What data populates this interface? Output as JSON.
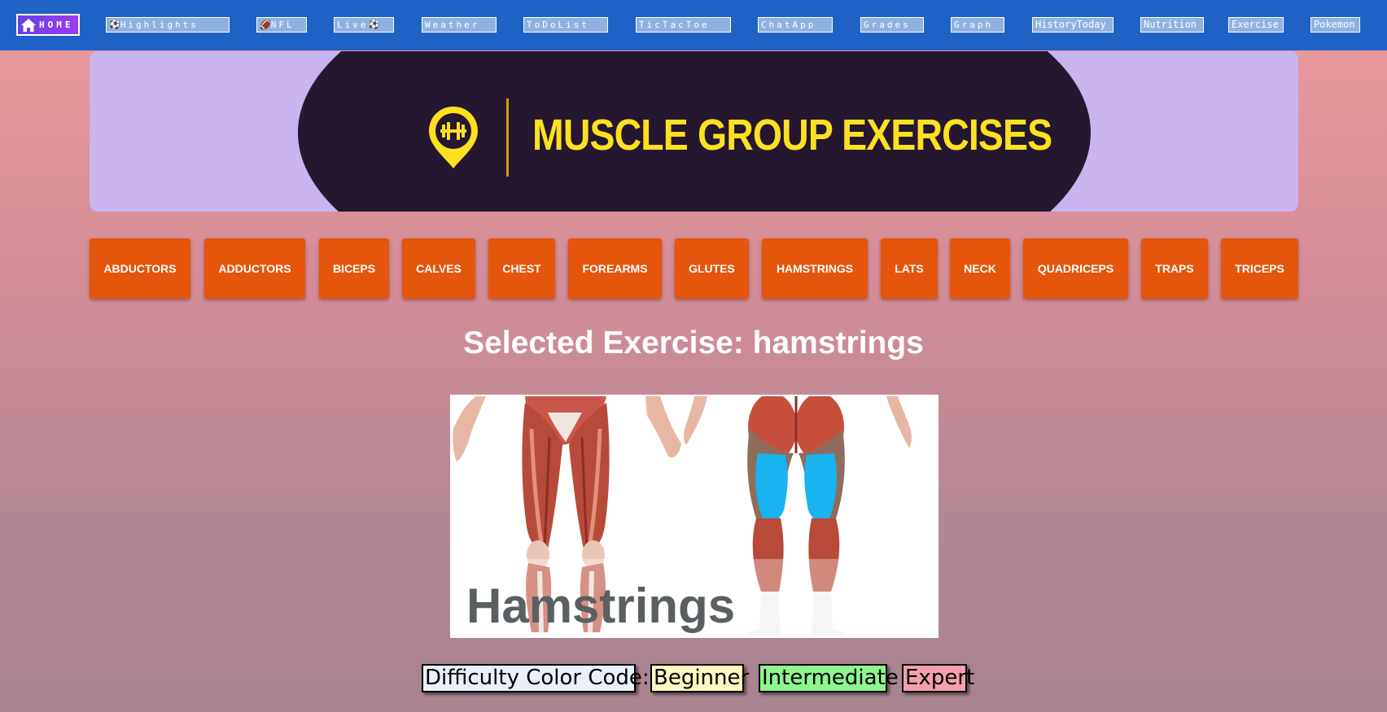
{
  "navbar": {
    "home_label": "HOME",
    "links": [
      {
        "label": "Highlights",
        "icon": "soccer-ball-icon"
      },
      {
        "label": "NFL",
        "icon": "football-icon"
      },
      {
        "label": "Live",
        "icon": "soccer-ball-icon"
      },
      {
        "label": "Weather"
      },
      {
        "label": "ToDoList"
      },
      {
        "label": "TicTacToe"
      },
      {
        "label": "ChatApp"
      },
      {
        "label": "Grades"
      },
      {
        "label": "Graph"
      },
      {
        "label": "HistoryToday"
      },
      {
        "label": "Nutrition"
      },
      {
        "label": "Exercise"
      },
      {
        "label": "Pokemon"
      }
    ]
  },
  "banner": {
    "title": "MUSCLE GROUP EXERCISES",
    "logo_icon": "dumbbell-pin-icon"
  },
  "muscle_groups": [
    "ABDUCTORS",
    "ADDUCTORS",
    "BICEPS",
    "CALVES",
    "CHEST",
    "FOREARMS",
    "GLUTES",
    "HAMSTRINGS",
    "LATS",
    "NECK",
    "QUADRICEPS",
    "TRAPS",
    "TRICEPS"
  ],
  "selected": {
    "prefix": "Selected Exercise:",
    "muscle": "hamstrings",
    "heading": "Selected Exercise: hamstrings",
    "image_caption": "Hamstrings"
  },
  "difficulty": {
    "label": "Difficulty Color Code:",
    "levels": [
      {
        "name": "Beginner",
        "color": "#fbf7c2"
      },
      {
        "name": "Intermediate",
        "color": "#8ef58f"
      },
      {
        "name": "Expert",
        "color": "#f3a0ac"
      }
    ]
  },
  "colors": {
    "navbar": "#1f62c6",
    "button": "#e5550b",
    "banner_bg": "#c9b4f0",
    "banner_dark": "#251730",
    "banner_title": "#fde021",
    "highlight_muscle": "#19b3ef"
  }
}
